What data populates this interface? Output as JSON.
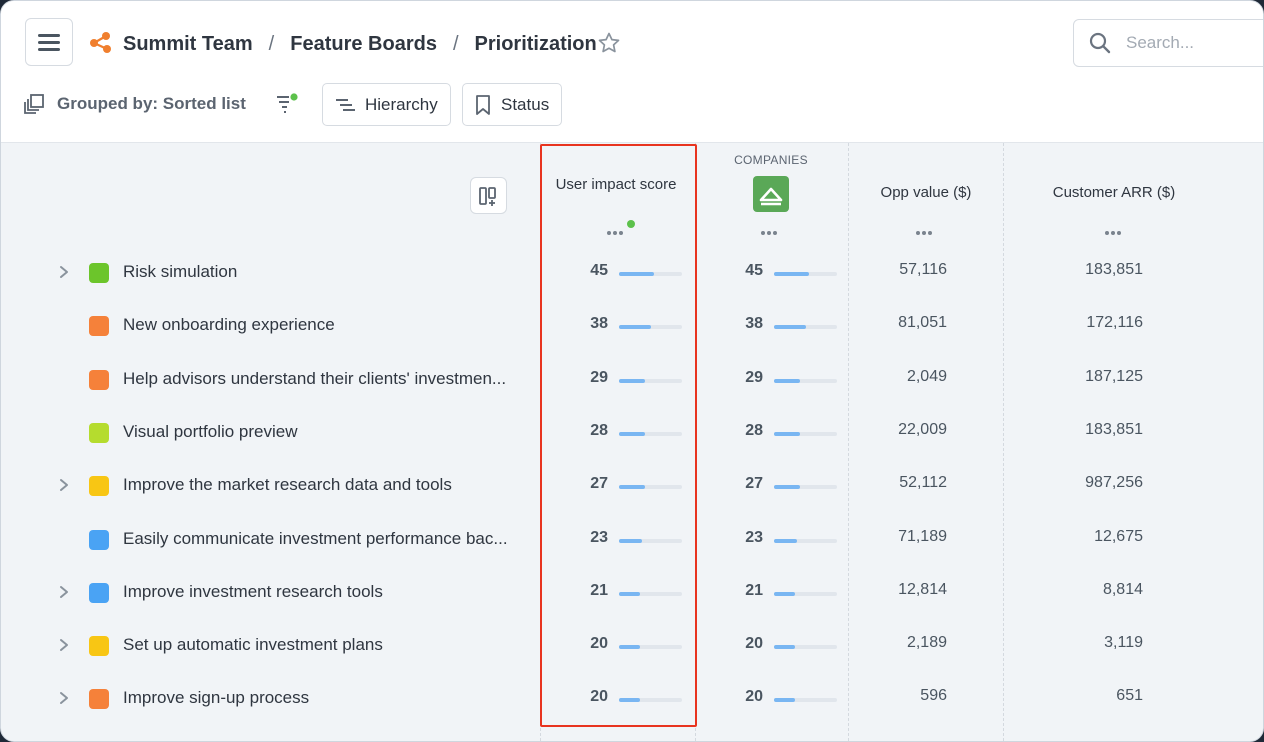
{
  "header": {
    "breadcrumb": [
      "Summit Team",
      "Feature Boards",
      "Prioritization"
    ],
    "separator": "/",
    "search_placeholder": "Search...",
    "grouped_by_label": "Grouped by: Sorted list",
    "hierarchy_label": "Hierarchy",
    "status_label": "Status"
  },
  "columns": {
    "user_impact": "User impact score",
    "companies_group": "COMPANIES",
    "opp_value": "Opp value ($)",
    "customer_arr": "Customer ARR ($)"
  },
  "colors": {
    "accent_bar": "#79b6f2",
    "highlight": "#e8341f",
    "filter_dot": "#5cc14b",
    "logo": "#f07f2e",
    "companies_icon_bg": "#5aa857"
  },
  "rows": [
    {
      "title": "Risk simulation",
      "expandable": true,
      "color": "#6cc52b",
      "impact": "45",
      "impact_fill": 0.55,
      "company": "45",
      "company_fill": 0.55,
      "opp": "57,116",
      "arr": "183,851"
    },
    {
      "title": "New onboarding experience",
      "expandable": false,
      "color": "#f5813a",
      "impact": "38",
      "impact_fill": 0.5,
      "company": "38",
      "company_fill": 0.5,
      "opp": "81,051",
      "arr": "172,116"
    },
    {
      "title": "Help advisors understand their clients' investmen...",
      "expandable": false,
      "color": "#f5813a",
      "impact": "29",
      "impact_fill": 0.42,
      "company": "29",
      "company_fill": 0.42,
      "opp": "2,049",
      "arr": "187,125"
    },
    {
      "title": "Visual portfolio preview",
      "expandable": false,
      "color": "#b5dc2e",
      "impact": "28",
      "impact_fill": 0.42,
      "company": "28",
      "company_fill": 0.42,
      "opp": "22,009",
      "arr": "183,851"
    },
    {
      "title": "Improve the market research data and tools",
      "expandable": true,
      "color": "#f8c614",
      "impact": "27",
      "impact_fill": 0.42,
      "company": "27",
      "company_fill": 0.42,
      "opp": "52,112",
      "arr": "987,256"
    },
    {
      "title": "Easily communicate investment performance bac...",
      "expandable": false,
      "color": "#4aa3f4",
      "impact": "23",
      "impact_fill": 0.36,
      "company": "23",
      "company_fill": 0.36,
      "opp": "71,189",
      "arr": "12,675"
    },
    {
      "title": "Improve investment research tools",
      "expandable": true,
      "color": "#4aa3f4",
      "impact": "21",
      "impact_fill": 0.34,
      "company": "21",
      "company_fill": 0.34,
      "opp": "12,814",
      "arr": "8,814"
    },
    {
      "title": "Set up automatic investment plans",
      "expandable": true,
      "color": "#f8c614",
      "impact": "20",
      "impact_fill": 0.33,
      "company": "20",
      "company_fill": 0.33,
      "opp": "2,189",
      "arr": "3,119"
    },
    {
      "title": "Improve sign-up process",
      "expandable": true,
      "color": "#f5813a",
      "impact": "20",
      "impact_fill": 0.33,
      "company": "20",
      "company_fill": 0.33,
      "opp": "596",
      "arr": "651"
    }
  ]
}
